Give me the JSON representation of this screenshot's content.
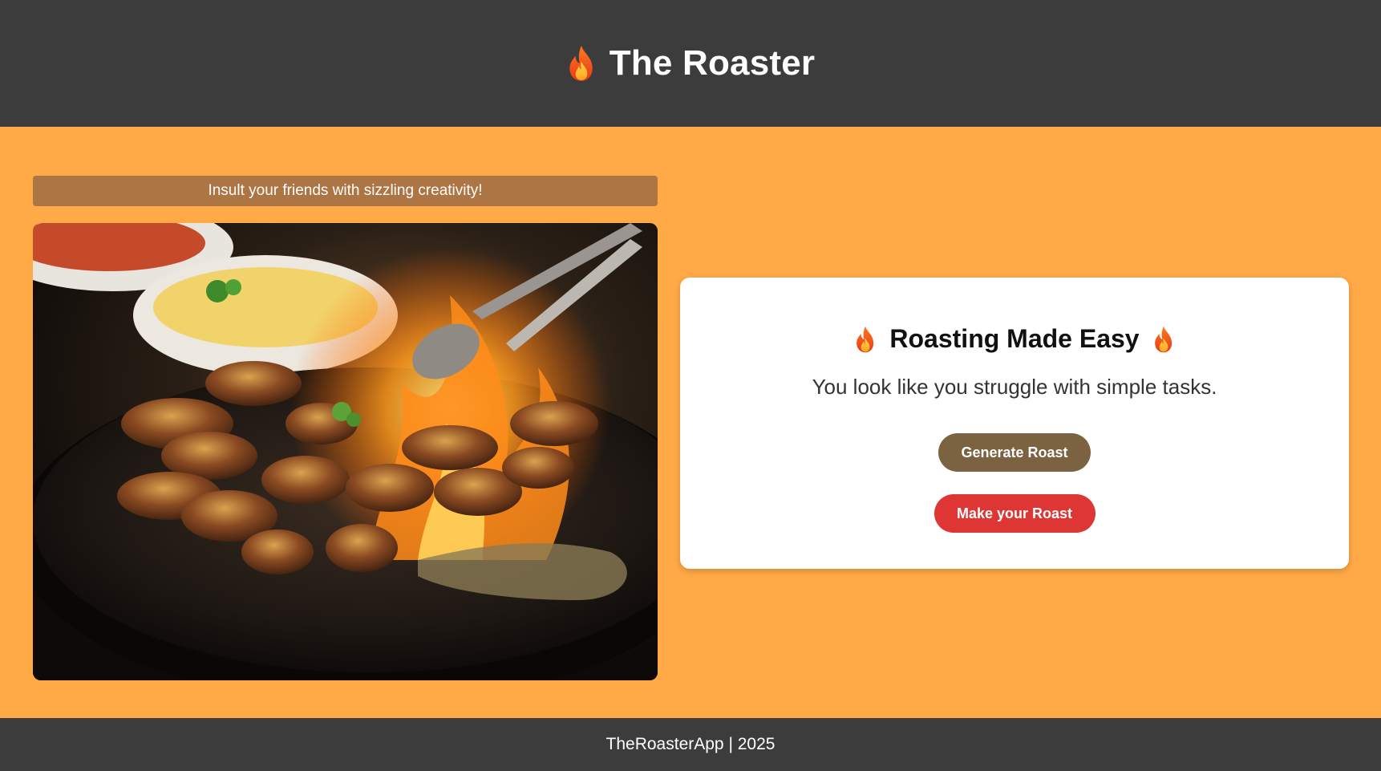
{
  "header": {
    "title": "The Roaster",
    "icon": "fire-icon"
  },
  "tagline": "Insult your friends with sizzling creativity!",
  "hero_image": {
    "alt": "Flaming skillet of seared mushrooms"
  },
  "card": {
    "title": "Roasting Made Easy",
    "roast_text": "You look like you struggle with simple tasks.",
    "generate_label": "Generate Roast",
    "make_label": "Make your Roast"
  },
  "footer": {
    "text": "TheRoasterApp | 2025"
  },
  "colors": {
    "page_bg": "#FFA947",
    "header_bg": "#3C3C3C",
    "tagline_bg": "#AD7444",
    "generate_btn": "#7B6241",
    "make_btn": "#DE3535"
  }
}
